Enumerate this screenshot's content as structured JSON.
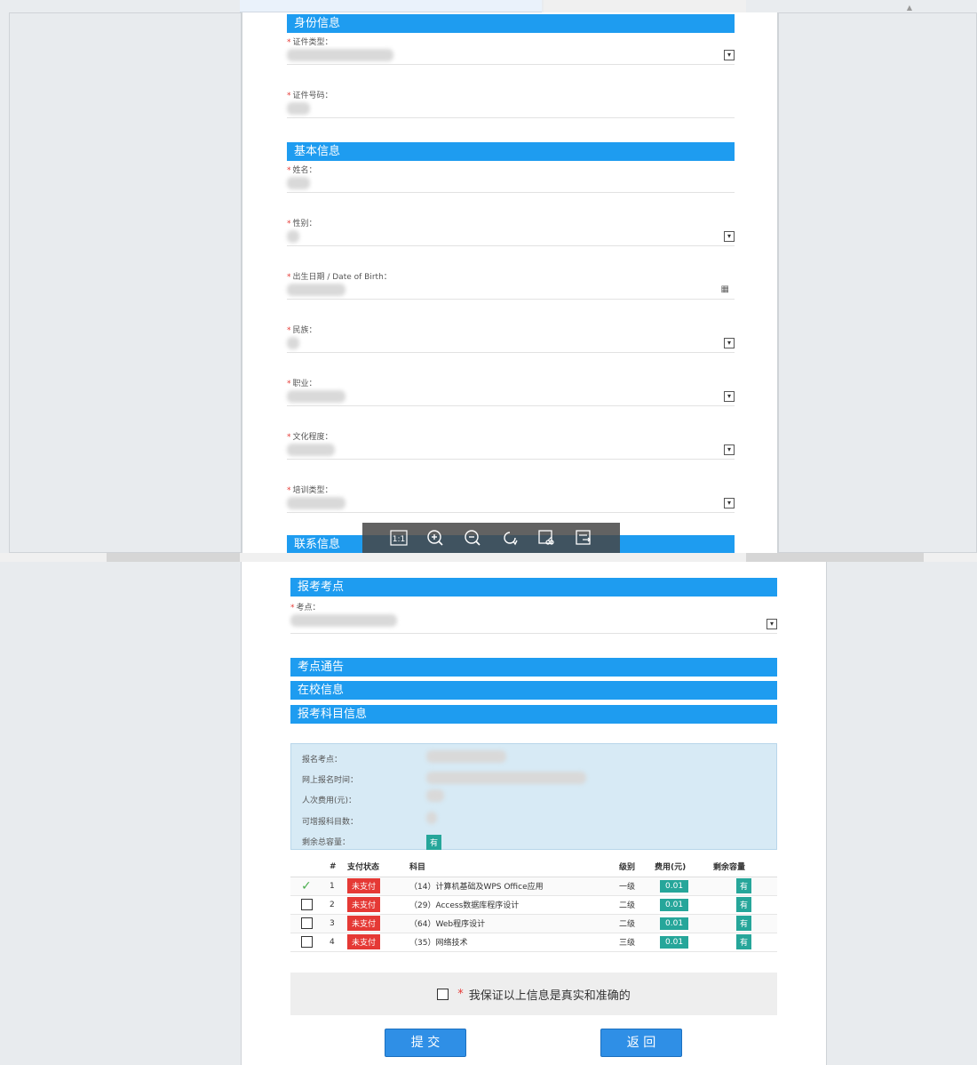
{
  "top_form": {
    "sections": {
      "identity": "身份信息",
      "basic": "基本信息",
      "contact": "联系信息"
    },
    "fields": [
      {
        "label": "证件类型",
        "required": true,
        "type": "select"
      },
      {
        "label": "证件号码",
        "required": true,
        "type": "text"
      },
      {
        "label": "姓名",
        "required": true,
        "type": "text"
      },
      {
        "label": "性别",
        "required": true,
        "type": "select"
      },
      {
        "label": "出生日期 / Date of Birth",
        "required": true,
        "type": "date"
      },
      {
        "label": "民族",
        "required": true,
        "type": "select"
      },
      {
        "label": "职业",
        "required": true,
        "type": "select"
      },
      {
        "label": "文化程度",
        "required": true,
        "type": "select"
      },
      {
        "label": "培训类型",
        "required": true,
        "type": "select"
      }
    ],
    "label_suffix": "：",
    "required_mark": "*"
  },
  "viewer_toolbar": {
    "buttons": [
      "actual-size",
      "zoom-in",
      "zoom-out",
      "rotate",
      "crop",
      "save"
    ],
    "actual_size_label": "1:1"
  },
  "bottom_form": {
    "sections": {
      "exam_site": "报考考点",
      "site_notice": "考点通告",
      "school_info": "在校信息",
      "subjects": "报考科目信息"
    },
    "site_field": {
      "label": "考点",
      "required": true
    },
    "info": {
      "site_label": "报名考点：",
      "time_label": "网上报名时间：",
      "fee_label": "人次费用(元)：",
      "count_label": "可增报科目数：",
      "capacity_label": "剩余总容量：",
      "capacity_value": "有"
    },
    "table": {
      "headers": [
        "",
        "#",
        "支付状态",
        "科目",
        "级别",
        "费用(元)",
        "剩余容量"
      ],
      "rows": [
        {
          "checked": true,
          "num": "1",
          "status": "未支付",
          "subject": "（14）计算机基础及WPS Office应用",
          "level": "一级",
          "fee": "0.01",
          "capacity": "有"
        },
        {
          "checked": false,
          "num": "2",
          "status": "未支付",
          "subject": "（29）Access数据库程序设计",
          "level": "二级",
          "fee": "0.01",
          "capacity": "有"
        },
        {
          "checked": false,
          "num": "3",
          "status": "未支付",
          "subject": "（64）Web程序设计",
          "level": "二级",
          "fee": "0.01",
          "capacity": "有"
        },
        {
          "checked": false,
          "num": "4",
          "status": "未支付",
          "subject": "（35）网络技术",
          "level": "三级",
          "fee": "0.01",
          "capacity": "有"
        }
      ]
    },
    "guarantee": {
      "star": "*",
      "text": "我保证以上信息是真实和准确的"
    },
    "buttons": {
      "submit": "提 交",
      "back": "返 回"
    }
  },
  "colors": {
    "section_blue": "#1e9cf0",
    "unpaid_red": "#e53935",
    "teal_badge": "#26a69a",
    "button_blue": "#2f8fe6"
  }
}
